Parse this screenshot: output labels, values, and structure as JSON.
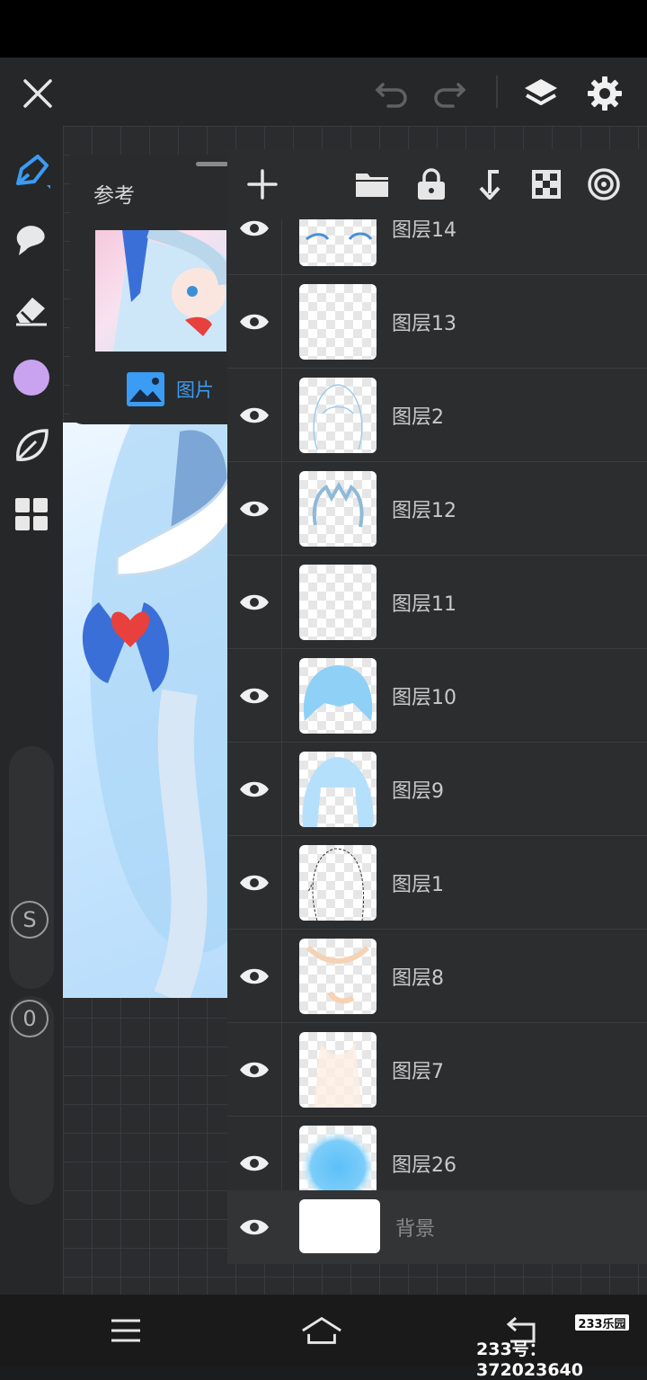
{
  "reference_panel": {
    "title": "参考",
    "image_button_label": "图片"
  },
  "colors": {
    "accent_blue": "#3a9cf4",
    "current_color": "#c9a3f0"
  },
  "left_tools": {
    "slider_s_label": "S",
    "slider_o_label": "0"
  },
  "layers": [
    {
      "name": "图层14"
    },
    {
      "name": "图层13"
    },
    {
      "name": "图层2"
    },
    {
      "name": "图层12"
    },
    {
      "name": "图层11"
    },
    {
      "name": "图层10"
    },
    {
      "name": "图层9"
    },
    {
      "name": "图层1"
    },
    {
      "name": "图层8"
    },
    {
      "name": "图层7"
    },
    {
      "name": "图层26"
    },
    {
      "name": "背景"
    }
  ],
  "watermark": {
    "logo": "233乐园",
    "text": "233号：372023640"
  }
}
